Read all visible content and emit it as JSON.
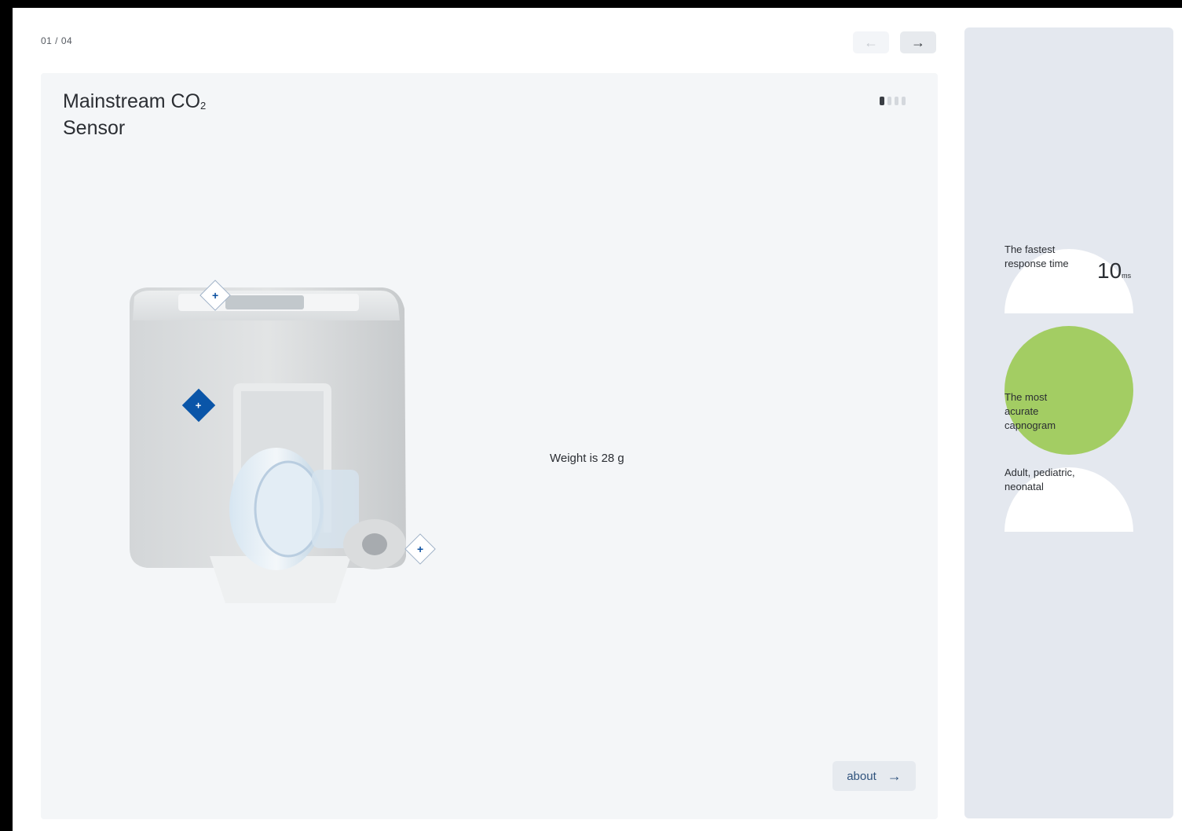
{
  "header": {
    "counter": "01 / 04",
    "prev_icon": "arrow-left-icon",
    "next_icon": "arrow-right-icon",
    "prev_glyph": "←",
    "next_glyph": "→"
  },
  "product": {
    "title_line1": "Mainstream CO",
    "title_sub": "2",
    "title_line2": "Sensor",
    "weight_text": "Weight is 28 g",
    "slides_total": 4,
    "slide_active": 1,
    "hotspot_glyph": "+"
  },
  "about": {
    "label": "about",
    "glyph": "→"
  },
  "sidebar": {
    "features": [
      {
        "label": "The fastest response time",
        "metric_value": "10",
        "metric_unit": "ms"
      },
      {
        "label": "The most acurate capnogram"
      },
      {
        "label": "Adult, pediatric, neonatal"
      }
    ],
    "colors": {
      "accent_green": "#a3cd63",
      "panel": "#e4e8ef"
    }
  },
  "colors": {
    "hotspot_blue": "#0a55a8"
  }
}
